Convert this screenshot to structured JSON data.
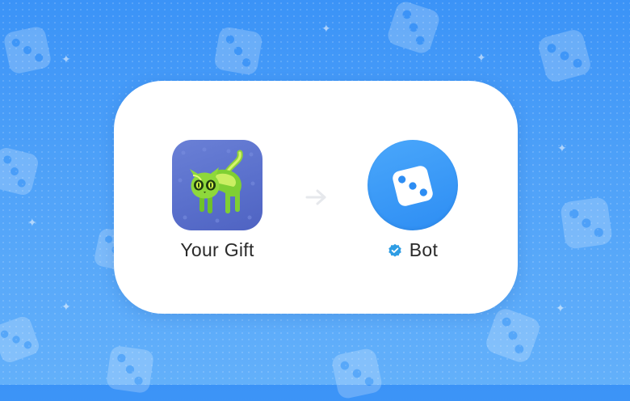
{
  "transfer_card": {
    "from": {
      "label": "Your Gift",
      "icon": "green-cat-gift-icon"
    },
    "arrow_icon": "arrow-right-icon",
    "to": {
      "label": "Bot",
      "icon": "dice-bot-avatar-icon",
      "badge_icon": "verified-badge-icon"
    }
  },
  "colors": {
    "background_top": "#3b93f7",
    "background_bottom": "#63b0fa",
    "card": "#ffffff",
    "gift_tile": "#5a70cc",
    "bot_avatar": "#2d8df3",
    "verified_badge": "#2f9de4",
    "label_text": "#2a2a2a"
  }
}
